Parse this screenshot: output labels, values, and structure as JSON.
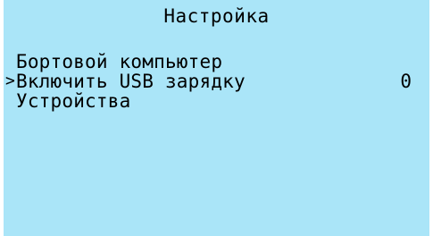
{
  "screen": {
    "title": "Настройка",
    "background_color": "#aae5f8",
    "text_color": "#000000"
  },
  "menu": {
    "cursor_symbol": ">",
    "selected_index": 1,
    "items": [
      {
        "label": "Бортовой компьютер",
        "value": ""
      },
      {
        "label": "Включить USB зарядку",
        "value": "0"
      },
      {
        "label": "Устройства",
        "value": ""
      }
    ]
  }
}
